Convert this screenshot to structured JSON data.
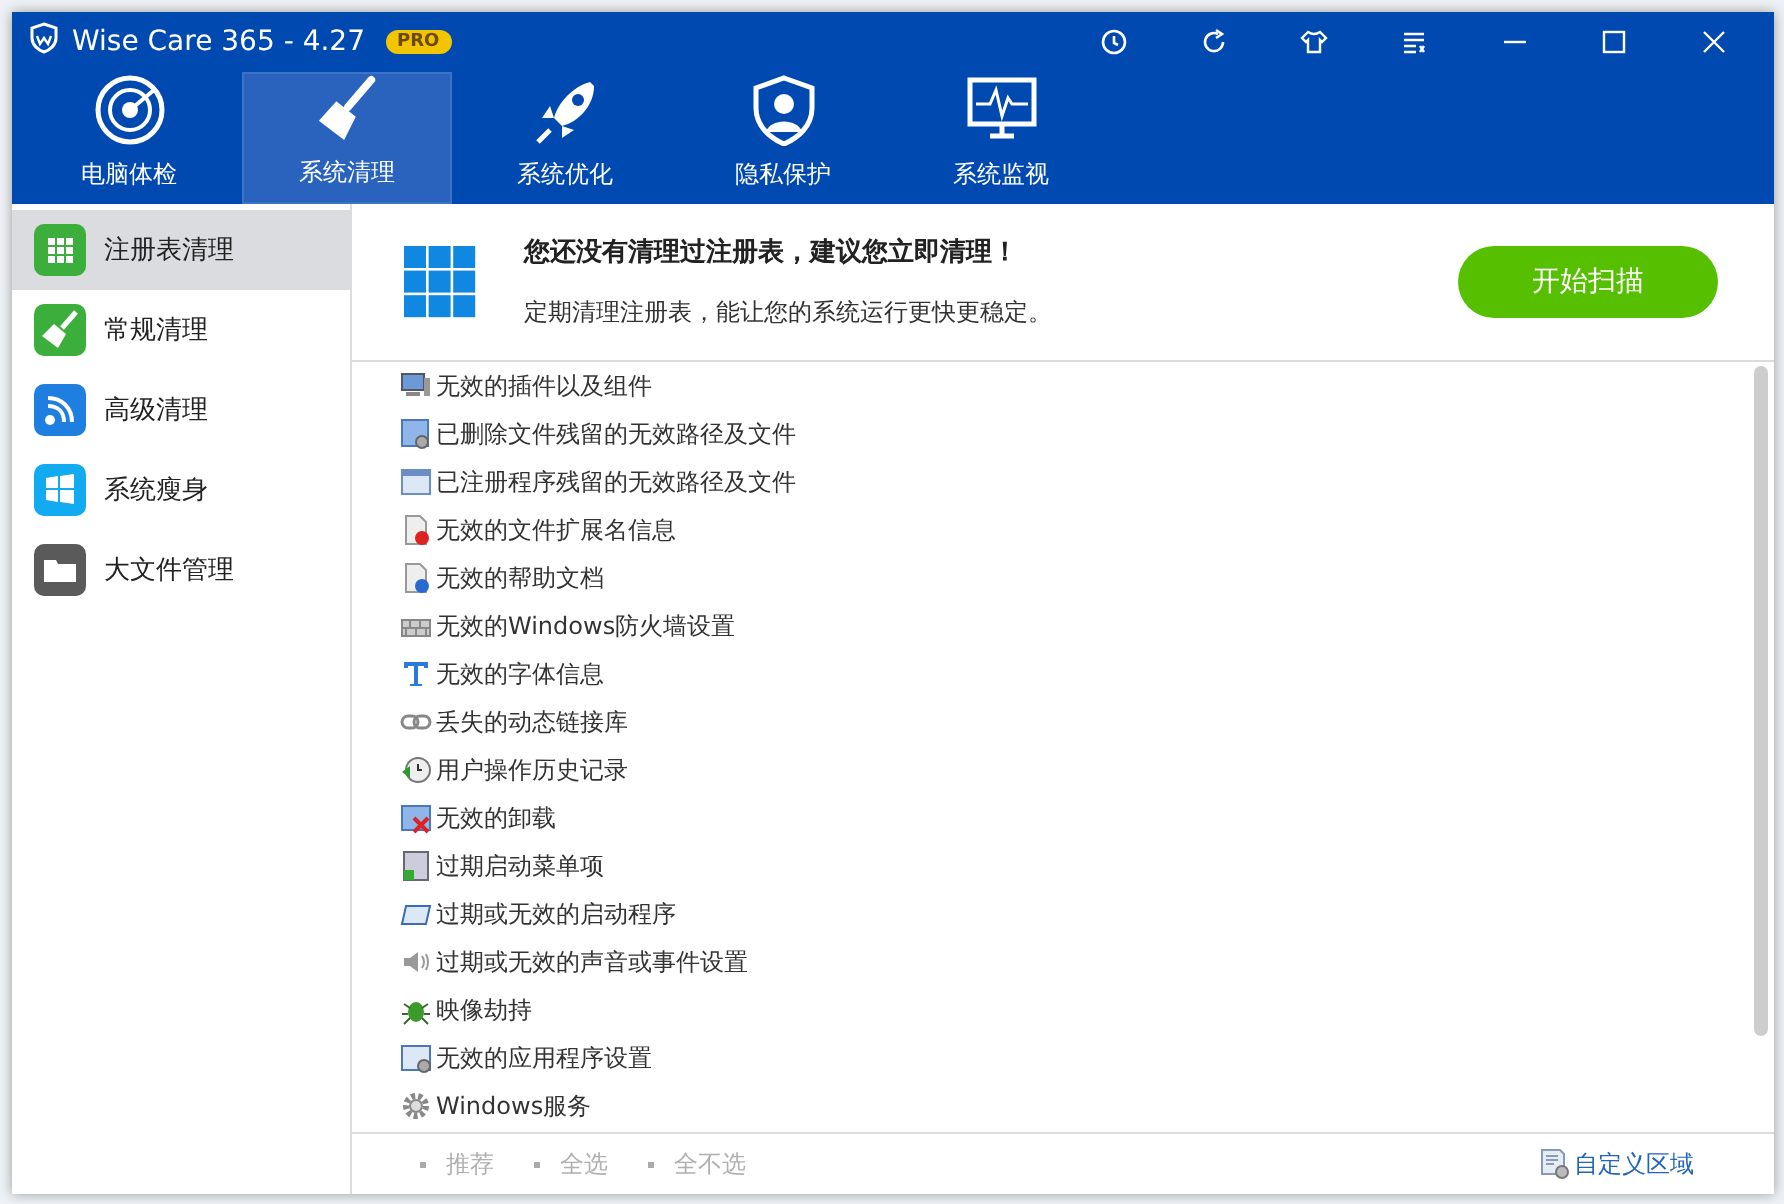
{
  "window": {
    "title": "Wise Care 365 - 4.27",
    "badge": "PRO"
  },
  "nav_tabs": [
    {
      "label": "电脑体检",
      "selected": false
    },
    {
      "label": "系统清理",
      "selected": true
    },
    {
      "label": "系统优化",
      "selected": false
    },
    {
      "label": "隐私保护",
      "selected": false
    },
    {
      "label": "系统监视",
      "selected": false
    }
  ],
  "sidebar": {
    "items": [
      {
        "label": "注册表清理",
        "selected": true,
        "color": "#3cae3c"
      },
      {
        "label": "常规清理",
        "selected": false,
        "color": "#3cae3c"
      },
      {
        "label": "高级清理",
        "selected": false,
        "color": "#1e7fe0"
      },
      {
        "label": "系统瘦身",
        "selected": false,
        "color": "#12aaf0"
      },
      {
        "label": "大文件管理",
        "selected": false,
        "color": "#5a5a5a"
      }
    ]
  },
  "header": {
    "title": "您还没有清理过注册表，建议您立即清理！",
    "subtitle": "定期清理注册表，能让您的系统运行更快更稳定。",
    "button": "开始扫描"
  },
  "items": [
    {
      "label": "无效的插件以及组件"
    },
    {
      "label": "已删除文件残留的无效路径及文件"
    },
    {
      "label": "已注册程序残留的无效路径及文件"
    },
    {
      "label": "无效的文件扩展名信息"
    },
    {
      "label": "无效的帮助文档"
    },
    {
      "label": "无效的Windows防火墙设置"
    },
    {
      "label": "无效的字体信息"
    },
    {
      "label": "丢失的动态链接库"
    },
    {
      "label": "用户操作历史记录"
    },
    {
      "label": "无效的卸载"
    },
    {
      "label": "过期启动菜单项"
    },
    {
      "label": "过期或无效的启动程序"
    },
    {
      "label": "过期或无效的声音或事件设置"
    },
    {
      "label": "映像劫持"
    },
    {
      "label": "无效的应用程序设置"
    },
    {
      "label": "Windows服务"
    }
  ],
  "footer": {
    "links": [
      {
        "label": "推荐",
        "disabled": true
      },
      {
        "label": "全选",
        "disabled": true
      },
      {
        "label": "全不选",
        "disabled": true
      }
    ],
    "custom_area": "自定义区域"
  }
}
